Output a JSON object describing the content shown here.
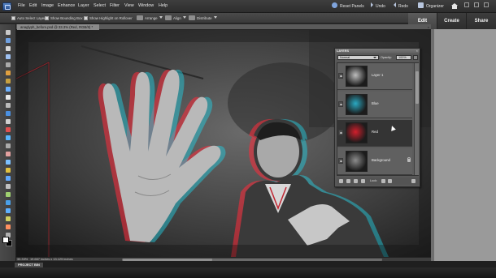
{
  "menubar": {
    "items": [
      "File",
      "Edit",
      "Image",
      "Enhance",
      "Layer",
      "Select",
      "Filter",
      "View",
      "Window",
      "Help"
    ],
    "reset_panels": "Reset Panels",
    "undo": "Undo",
    "redo": "Redo",
    "organizer": "Organizer"
  },
  "options_bar": {
    "auto_select_layer": "Auto Select Layer",
    "show_bounding_box": "Show Bounding Box",
    "show_highlight": "Show Highlight on Rollover",
    "arrange": "Arrange",
    "align": "Align",
    "distribute": "Distribute"
  },
  "mode_tabs": {
    "edit": "Edit",
    "create": "Create",
    "share": "Share",
    "active": "Edit"
  },
  "document": {
    "tab_label": "anaglyph_before.psd @ 33.3% (Red, RGB/8) *",
    "close_glyph": "×"
  },
  "status_bar": {
    "zoom": "33.33%",
    "size": "19.667 inches x 13.125 inches"
  },
  "project_bin": {
    "label": "PROJECT BIN"
  },
  "layers_panel": {
    "title": "LAYERS",
    "close_glyph": "×",
    "blend_mode": "Normal",
    "opacity_label": "Opacity:",
    "opacity_value": "100%",
    "lock_label": "Lock:",
    "layers": [
      {
        "name": "Layer 1",
        "tint": "#bdbdbd",
        "active": false
      },
      {
        "name": "Blue",
        "tint": "#2aa9c2",
        "active": false
      },
      {
        "name": "Red",
        "tint": "#d21f2c",
        "active": true
      },
      {
        "name": "Background",
        "tint": "#8d8d8d",
        "active": false
      }
    ]
  },
  "colors": {
    "accent_edit_tab": "#4d4d4d",
    "selected_layer": "#343434",
    "anaglyph_red": "#ff2a3a",
    "anaglyph_cyan": "#21d4e8"
  },
  "icons": {
    "app": "photoshop-elements-logo",
    "reset": "reset-panels-icon",
    "undo": "undo-icon",
    "redo": "redo-icon",
    "organizer": "organizer-icon",
    "home": "home-icon"
  }
}
